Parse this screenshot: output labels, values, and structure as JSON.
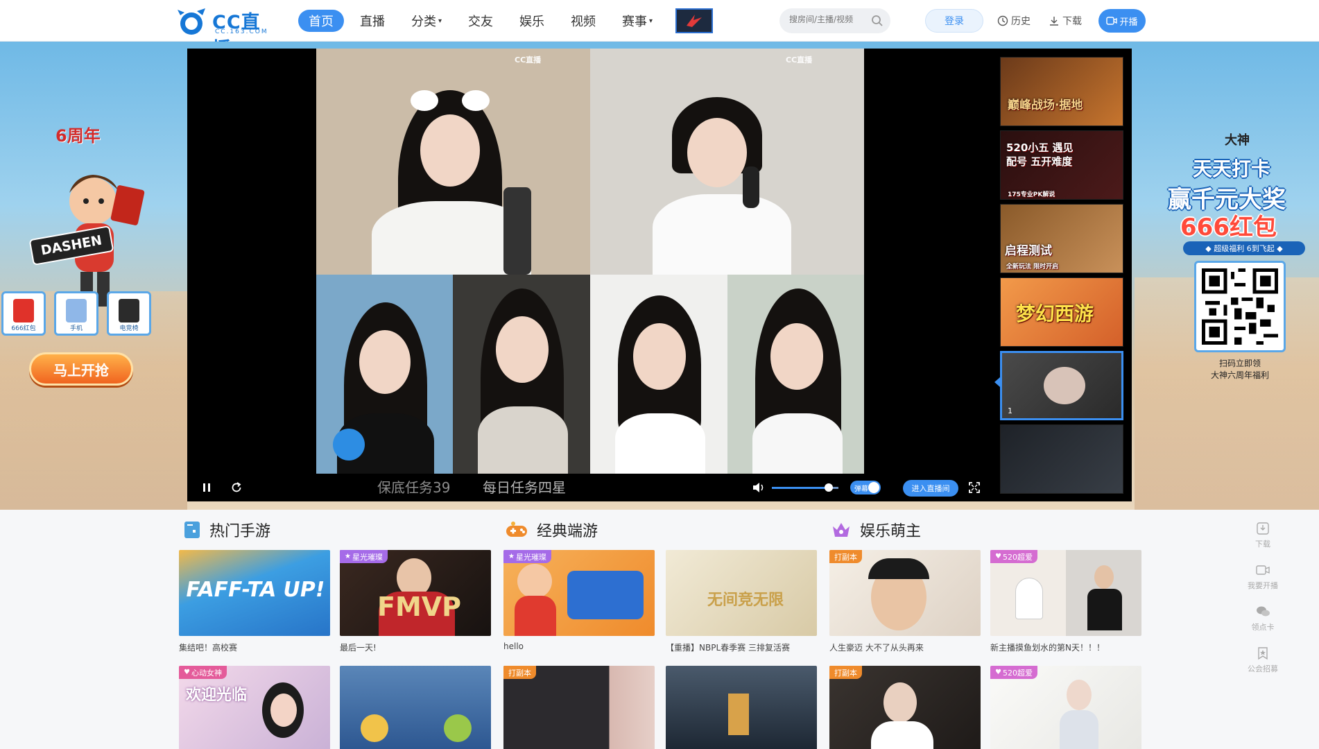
{
  "header": {
    "logo_text": "CC直播",
    "logo_sub": "CC.163.COM",
    "nav": [
      {
        "label": "首页",
        "active": true
      },
      {
        "label": "直播"
      },
      {
        "label": "分类",
        "caret": "▾"
      },
      {
        "label": "交友"
      },
      {
        "label": "娱乐"
      },
      {
        "label": "视频"
      },
      {
        "label": "赛事",
        "caret": "▾"
      }
    ],
    "search_placeholder": "搜房间/主播/视频",
    "login_label": "登录",
    "history_label": "历史",
    "download_label": "下载",
    "start_label": "开播"
  },
  "promo_left": {
    "anniversary": "6周年",
    "banner": "DASHEN",
    "prizes": [
      "666红包",
      "手机",
      "电竞椅"
    ],
    "cta": "马上开抢"
  },
  "promo_right": {
    "brand": "大神",
    "line1": "天天打卡",
    "line2": "赢千元大奖",
    "line3": "666红包",
    "strip": "◆ 超级福利 6到飞起 ◆",
    "qr_caption_1": "扫码立即领",
    "qr_caption_2": "大神六周年福利"
  },
  "player": {
    "watermark": "CC直播",
    "ticker_1": "保底任务39",
    "ticker_2": "每日任务四星",
    "volume": 0.85,
    "danmu_label": "弹幕",
    "enter_label": "进入直播间",
    "thumbs": [
      {
        "title": "巅峰战场·据地",
        "bg": "#6b3a1a"
      },
      {
        "title": "520小五 遇见配号 五开难度",
        "sub": "175专业PK解说",
        "bg": "#2a0f0f"
      },
      {
        "title": "启程测试",
        "sub": "全新玩法 限时开启",
        "bg": "#8a5a2a"
      },
      {
        "title": "梦幻西游",
        "bg": "#e07b3a"
      },
      {
        "title": "",
        "num": "1",
        "bg": "#3a3a3a",
        "active": true
      },
      {
        "title": "",
        "bg": "#1e2228"
      }
    ]
  },
  "sections": [
    {
      "title": "热门手游",
      "icon": "phone-game-icon"
    },
    {
      "title": "经典端游",
      "icon": "gamepad-icon"
    },
    {
      "title": "娱乐萌主",
      "icon": "crown-icon"
    }
  ],
  "cards_row1": [
    {
      "caption": "集结吧！高校赛",
      "tag": "",
      "bg": "#3c9ee2"
    },
    {
      "caption": "最后一天!",
      "tag": "星光璀璨",
      "tag_color": "#a56be8",
      "bg": "#2c1e1a"
    },
    {
      "caption": "hello",
      "tag": "星光璀璨",
      "tag_color": "#a56be8",
      "bg": "#f39c3b"
    },
    {
      "caption": "【重播】NBPL春季赛 三排复活赛",
      "tag": "",
      "bg": "#ede2c6"
    },
    {
      "caption": "人生豪迈 大不了从头再来",
      "tag": "打副本",
      "tag_color": "#ef8b2c",
      "bg": "#efe7dc"
    },
    {
      "caption": "新主播摸鱼划水的第N天！！！",
      "tag": "520超爱",
      "tag_color": "#d56cd1",
      "bg": "#ebe7e3"
    }
  ],
  "cards_row2": [
    {
      "tag": "心动女神",
      "tag_color": "#e45b9a",
      "bg": "#e8d4e4"
    },
    {
      "tag": "",
      "bg": "#3a6fa8"
    },
    {
      "tag": "打副本",
      "tag_color": "#ef8b2c",
      "bg": "#2c2a2e"
    },
    {
      "tag": "",
      "bg": "#2c3a4a"
    },
    {
      "tag": "打副本",
      "tag_color": "#ef8b2c",
      "bg": "#2a2624"
    },
    {
      "tag": "520超爱",
      "tag_color": "#d56cd1",
      "bg": "#f2f2f0"
    }
  ],
  "tools": [
    "下载",
    "我要开播",
    "领点卡",
    "公会招募"
  ]
}
